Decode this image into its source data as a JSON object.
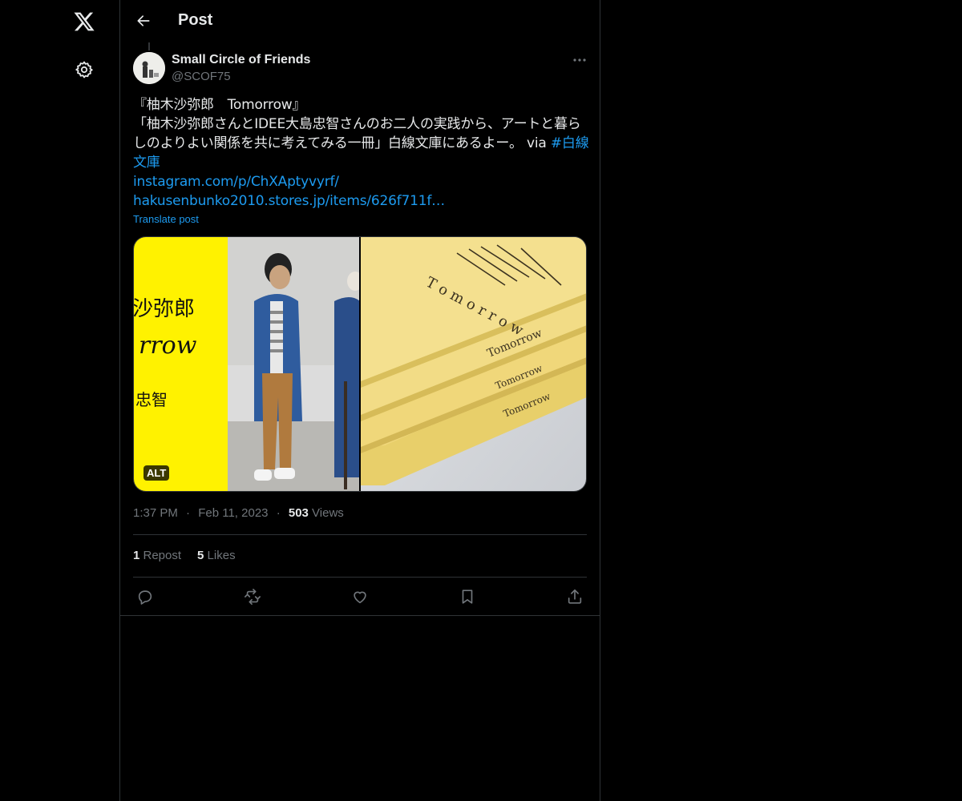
{
  "nav": {
    "logo_icon": "x-logo-icon",
    "settings_icon": "gear-icon"
  },
  "header": {
    "back_icon": "arrow-left-icon",
    "title": "Post"
  },
  "post": {
    "author": {
      "name": "Small Circle of Friends",
      "handle": "@SCOF75"
    },
    "text": {
      "line1": "『柚木沙弥郎　Tomorrow』",
      "line2": "「柚木沙弥郎さんとIDEE大島忠智さんのお二人の実践から、アートと暮ら",
      "line3": "しのよりよい関係を共に考えてみる一冊」白線文庫にあるよー。 via ",
      "hashtag_part1": "#白線",
      "hashtag_part2": "文庫",
      "link1": "instagram.com/p/ChXAptyvyrf/",
      "link2": "hakusenbunko2010.stores.jp/items/626f711f…"
    },
    "translate_label": "Translate post",
    "media": {
      "alt_badge": "ALT",
      "left_title_1": "沙弥郎",
      "left_title_2": "rrow",
      "left_title_3": "忠智"
    },
    "meta": {
      "time": "1:37 PM",
      "dot": "·",
      "date": "Feb 11, 2023",
      "views_count": "503",
      "views_label": " Views"
    },
    "stats": {
      "reposts_count": "1",
      "reposts_label": " Repost",
      "likes_count": "5",
      "likes_label": " Likes"
    },
    "actions": {
      "reply_icon": "reply-icon",
      "repost_icon": "repost-icon",
      "like_icon": "heart-icon",
      "bookmark_icon": "bookmark-icon",
      "share_icon": "share-icon"
    }
  },
  "colors": {
    "background": "#000000",
    "text": "#e7e9ea",
    "muted": "#71767b",
    "accent": "#1d9bf0",
    "border": "#2f3336",
    "book_yellow": "#f2dc86",
    "cover_yellow": "#fff200"
  }
}
